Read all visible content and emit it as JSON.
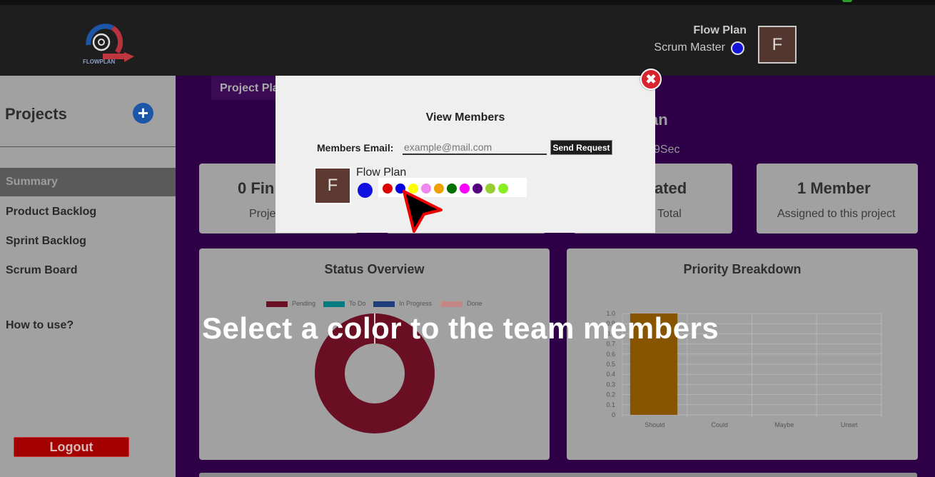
{
  "header": {
    "user_name": "Flow Plan",
    "user_role": "Scrum Master",
    "avatar_letter": "F",
    "logo_text": "FLOWPLAN"
  },
  "sidebar": {
    "title": "Projects",
    "add_label": "+",
    "items": [
      {
        "label": "Summary",
        "active": true
      },
      {
        "label": "Product Backlog"
      },
      {
        "label": "Sprint Backlog"
      },
      {
        "label": "Scrum Board"
      }
    ],
    "help_label": "How to use?",
    "logout_label": "Logout"
  },
  "main": {
    "project_tab": "Project Pla",
    "title_fragment": "an",
    "time_fragment": "9Sec",
    "cards": [
      {
        "big": "0 Fin",
        "small": "Proje"
      },
      {
        "big": "ated",
        "small": "Total"
      },
      {
        "big": "1 Member",
        "small": "Assigned to this project"
      }
    ],
    "status_title": "Status Overview",
    "priority_title": "Priority Breakdown",
    "caption": "Select a color to the team members"
  },
  "chart_data": [
    {
      "type": "pie",
      "title": "Status Overview",
      "labels": [
        "Pending",
        "To Do",
        "In Progress",
        "Done"
      ],
      "values": [
        1,
        0,
        0,
        0
      ],
      "colors": [
        "#6a0e23",
        "#007b7f",
        "#1e3f7a",
        "#c48787"
      ],
      "legend": "top"
    },
    {
      "type": "bar",
      "title": "Priority Breakdown",
      "categories": [
        "Should",
        "Could",
        "Maybe",
        "Unset"
      ],
      "values": [
        1,
        0,
        0,
        0
      ],
      "ylim": [
        0,
        1
      ],
      "yticks": [
        "0",
        "0.1",
        "0.2",
        "0.3",
        "0.4",
        "0.5",
        "0.6",
        "0.7",
        "0.8",
        "0.9",
        "1.0"
      ],
      "color": "#875400",
      "grid": true
    }
  ],
  "modal": {
    "title": "View Members",
    "email_label": "Members Email:",
    "email_placeholder": "example@mail.com",
    "send_label": "Send Request",
    "close_label": "✖",
    "member": {
      "letter": "F",
      "name": "Flow Plan",
      "selected_color": "#1212e0"
    },
    "palette": [
      "#e00000",
      "#0000e0",
      "#ffff00",
      "#ee88ee",
      "#f0a000",
      "#007000",
      "#ff00ff",
      "#550080",
      "#99cc33",
      "#88ee22"
    ]
  }
}
